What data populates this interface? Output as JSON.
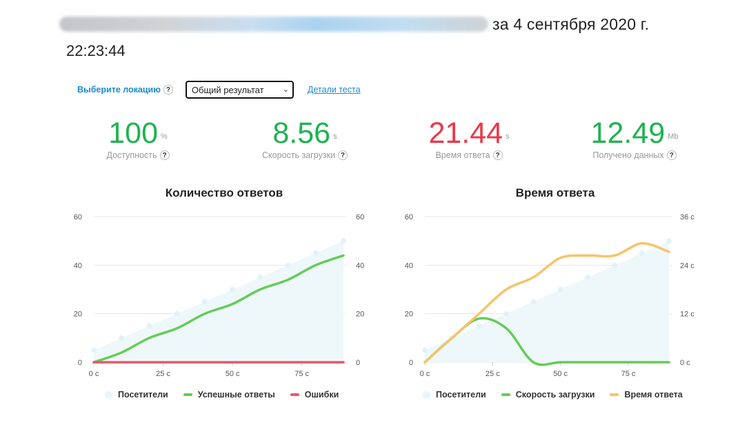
{
  "header": {
    "title_suffix": "за 4 сентября 2020 г.",
    "time": "22:23:44"
  },
  "controls": {
    "location_label": "Выберите локацию",
    "help": "?",
    "select_value": "Общий результат",
    "details_link": "Детали теста"
  },
  "metrics": [
    {
      "value": "100",
      "unit": "%",
      "label": "Доступность",
      "color": "#1db34f"
    },
    {
      "value": "8.56",
      "unit": "s",
      "label": "Скорость загрузки",
      "color": "#1db34f"
    },
    {
      "value": "21.44",
      "unit": "s",
      "label": "Время ответа",
      "color": "#e8394a"
    },
    {
      "value": "12.49",
      "unit": "Mb",
      "label": "Получено данных",
      "color": "#1db34f"
    }
  ],
  "colors": {
    "visitors": "#e6f5f9",
    "success": "#64cc57",
    "errors": "#f0546a",
    "response_time": "#f6c46a"
  },
  "chart_data": [
    {
      "type": "line",
      "title": "Количество ответов",
      "x": [
        0,
        10,
        20,
        30,
        40,
        50,
        60,
        70,
        80,
        90
      ],
      "xticks": [
        "0 с",
        "25 с",
        "50 с",
        "75 с"
      ],
      "xtick_values": [
        0,
        25,
        50,
        75
      ],
      "xlim": [
        0,
        90
      ],
      "ylim_left": [
        0,
        60
      ],
      "ylim_right": [
        0,
        60
      ],
      "yticks_left": [
        "0",
        "20",
        "40",
        "60"
      ],
      "yticks_right": [
        "0",
        "20",
        "40",
        "60"
      ],
      "series": [
        {
          "name": "Посетители",
          "kind": "area",
          "axis": "left",
          "values": [
            5,
            10,
            15,
            20,
            25,
            30,
            35,
            40,
            45,
            50
          ]
        },
        {
          "name": "Успешные ответы",
          "kind": "line",
          "axis": "left",
          "values": [
            0,
            4,
            10,
            14,
            20,
            24,
            30,
            34,
            40,
            44
          ]
        },
        {
          "name": "Ошибки",
          "kind": "line",
          "axis": "left",
          "values": [
            0,
            0,
            0,
            0,
            0,
            0,
            0,
            0,
            0,
            0
          ]
        }
      ],
      "grid": true,
      "legend": "bottom"
    },
    {
      "type": "line",
      "title": "Время ответа",
      "x": [
        0,
        10,
        20,
        30,
        40,
        50,
        60,
        70,
        80,
        90
      ],
      "xticks": [
        "0 с",
        "25 с",
        "50 с",
        "75 с"
      ],
      "xtick_values": [
        0,
        25,
        50,
        75
      ],
      "xlim": [
        0,
        90
      ],
      "ylim_left": [
        0,
        60
      ],
      "ylim_right": [
        0,
        36
      ],
      "yticks_left": [
        "0",
        "20",
        "40",
        "60"
      ],
      "yticks_right": [
        "0 с",
        "12 с",
        "24 с",
        "36 с"
      ],
      "series": [
        {
          "name": "Посетители",
          "kind": "area",
          "axis": "left",
          "values": [
            5,
            10,
            15,
            20,
            25,
            30,
            35,
            40,
            45,
            50
          ]
        },
        {
          "name": "Скорость загрузки",
          "kind": "line",
          "axis": "left",
          "values": [
            0,
            10,
            18,
            14,
            0,
            0,
            0,
            0,
            0,
            0
          ]
        },
        {
          "name": "Время ответа",
          "kind": "line",
          "axis": "right",
          "values": [
            0,
            6,
            12,
            18,
            21,
            25.8,
            26.4,
            26.4,
            29.4,
            27.3
          ]
        }
      ],
      "grid": true,
      "legend": "bottom"
    }
  ]
}
